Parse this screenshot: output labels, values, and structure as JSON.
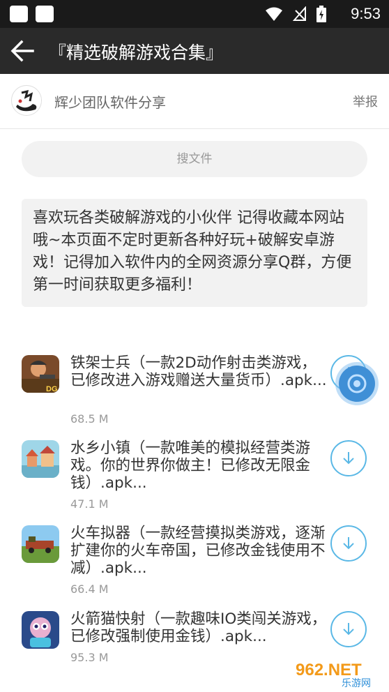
{
  "status": {
    "time": "9:53"
  },
  "header": {
    "title": "『精选破解游戏合集』"
  },
  "author": {
    "name": "辉少团队软件分享",
    "report": "举报"
  },
  "search": {
    "placeholder": "搜文件"
  },
  "description": "喜欢玩各类破解游戏的小伙伴 记得收藏本网站哦~本页面不定时更新各种好玩+破解安卓游戏！记得加入软件内的全网资源分享Q群，方便第一时间获取更多福利！",
  "files": [
    {
      "title": "铁架士兵（一款2D动作射击类游戏，已修改进入游戏赠送大量货币）.apk...",
      "size": "68.5 M"
    },
    {
      "title": "水乡小镇（一款唯美的模拟经营类游戏。你的世界你做主！已修改无限金钱）.apk...",
      "size": "47.1 M"
    },
    {
      "title": "火车拟器（一款经营摸拟类游戏，逐渐扩建你的火车帝国，已修改金钱使用不减）.apk...",
      "size": "66.4 M"
    },
    {
      "title": "火箭猫快射（一款趣味IO类闯关游戏，已修改强制使用金钱）.apk...",
      "size": "95.3 M"
    }
  ],
  "watermark": {
    "brand": "962.NET",
    "sub": "乐游网"
  },
  "colors": {
    "accent": "#5ab8e6",
    "appbar": "#2a2a2a",
    "statusbar": "#1a1a1a"
  }
}
